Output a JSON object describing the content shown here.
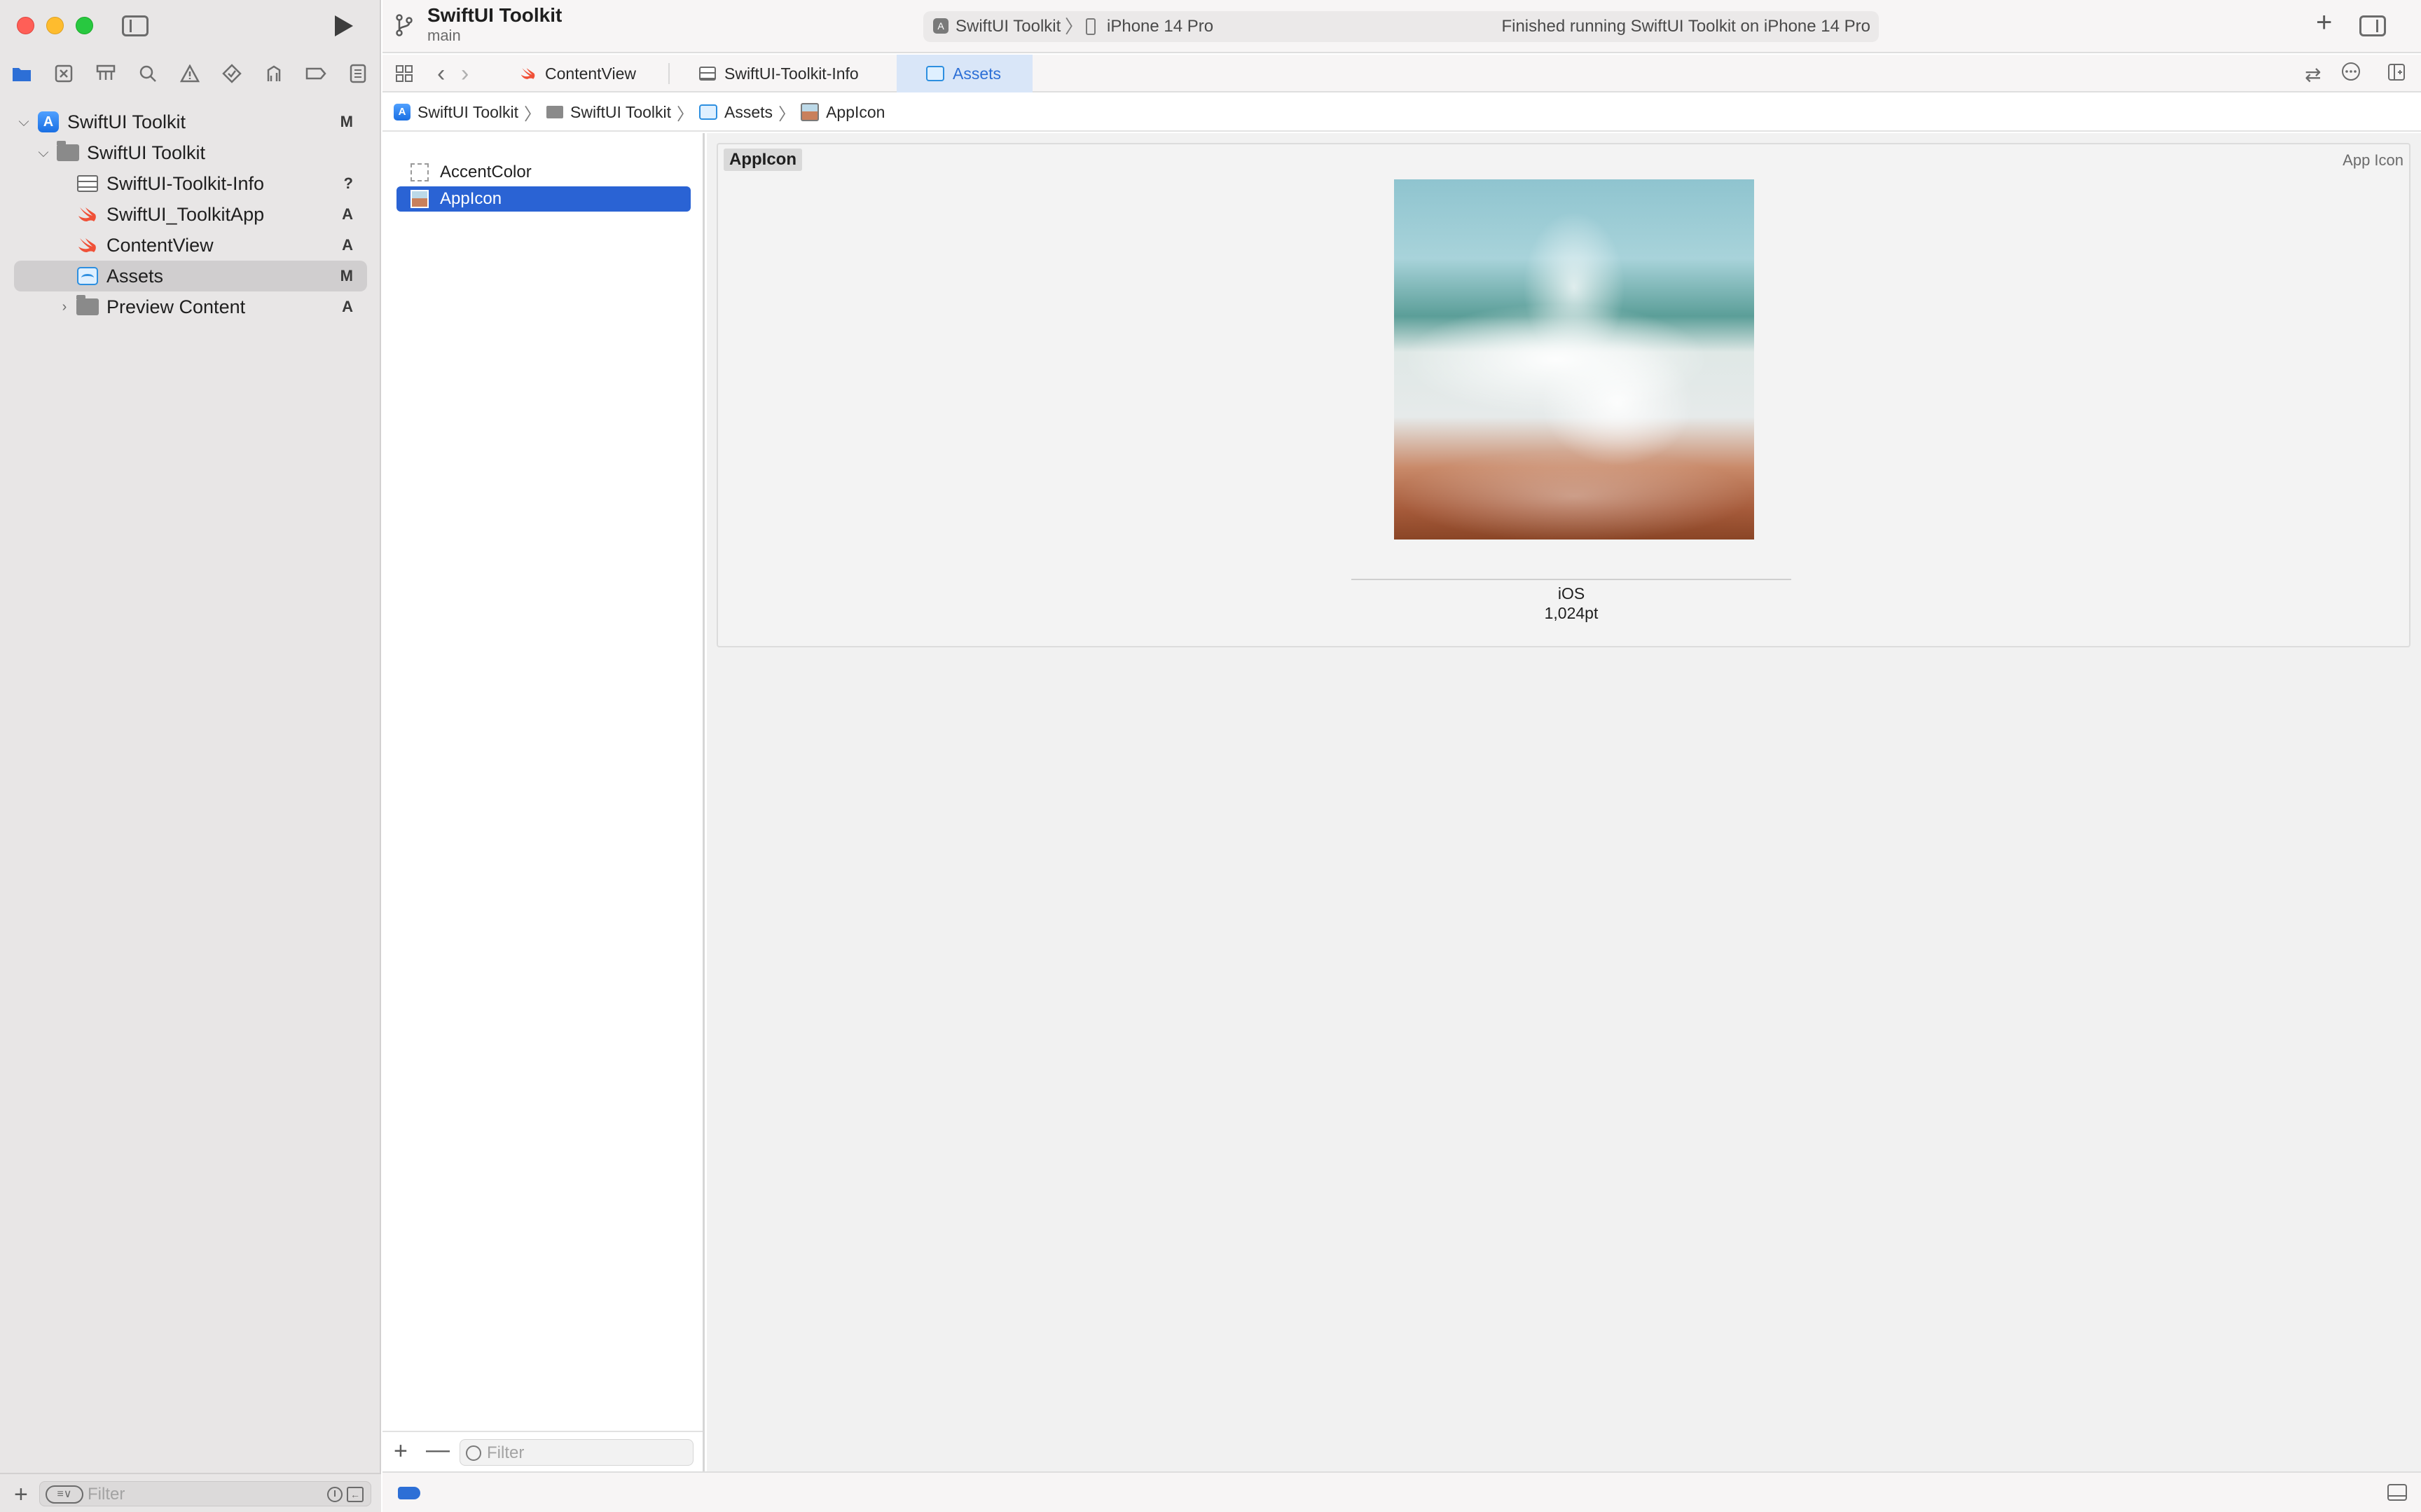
{
  "toolbar": {
    "project_title": "SwiftUI Toolkit",
    "branch": "main",
    "scheme": "SwiftUI Toolkit",
    "device": "iPhone 14 Pro",
    "status": "Finished running SwiftUI Toolkit on iPhone 14 Pro"
  },
  "navigator_tabs": [
    "folder-icon",
    "source-control-icon",
    "symbol-icon",
    "search-icon",
    "warning-icon",
    "test-icon",
    "debug-icon",
    "breakpoint-icon",
    "report-icon"
  ],
  "tree": {
    "root": {
      "label": "SwiftUI Toolkit",
      "badge": "M"
    },
    "group": {
      "label": "SwiftUI Toolkit",
      "badge": ""
    },
    "items": [
      {
        "label": "SwiftUI-Toolkit-Info",
        "badge": "?"
      },
      {
        "label": "SwiftUI_ToolkitApp",
        "badge": "A"
      },
      {
        "label": "ContentView",
        "badge": "A"
      },
      {
        "label": "Assets",
        "badge": "M"
      },
      {
        "label": "Preview Content",
        "badge": "A"
      }
    ]
  },
  "sidebar_filter": {
    "placeholder": "Filter"
  },
  "tabs": [
    {
      "label": "ContentView"
    },
    {
      "label": "SwiftUI-Toolkit-Info"
    },
    {
      "label": "Assets"
    }
  ],
  "jumpbar": {
    "items": [
      "SwiftUI Toolkit",
      "SwiftUI Toolkit",
      "Assets",
      "AppIcon"
    ]
  },
  "asset_list": {
    "items": [
      {
        "label": "AccentColor"
      },
      {
        "label": "AppIcon"
      }
    ],
    "filter_placeholder": "Filter"
  },
  "editor": {
    "panel_title": "AppIcon",
    "panel_type": "App Icon",
    "slot_platform": "iOS",
    "slot_size": "1,024pt"
  },
  "colors": {
    "accent": "#2d6fd6",
    "selection": "#2a63d4",
    "sidebar_bg": "#e8e6e6"
  }
}
